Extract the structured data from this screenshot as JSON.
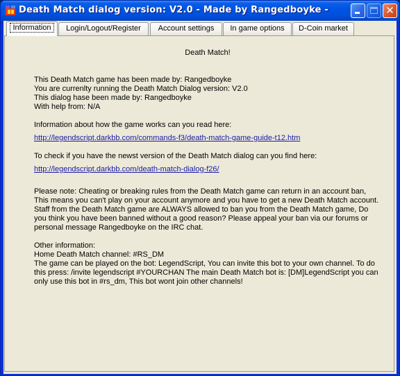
{
  "window": {
    "title": "Death Match dialog version: V2.0 - Made by Rangedboyke -",
    "app_icon": "app-icon",
    "controls": {
      "minimize": "minimize-icon",
      "maximize": "maximize-icon",
      "close": "close-icon",
      "close_glyph": "✕"
    }
  },
  "tabs": [
    {
      "label": "Information",
      "active": true
    },
    {
      "label": "Login/Logout/Register",
      "active": false
    },
    {
      "label": "Account settings",
      "active": false
    },
    {
      "label": "In game options",
      "active": false
    },
    {
      "label": "D-Coin market",
      "active": false
    }
  ],
  "info": {
    "heading": "Death Match!",
    "credits": [
      "This Death Match game has been made by: Rangedboyke",
      "You are currenlty running the Death Match Dialog version: V2.0",
      "This dialog hase been made by: Rangedboyke",
      "With help from: N/A"
    ],
    "guide_text": "Information about how the game works can you read here:",
    "guide_link": "http://legendscript.darkbb.com/commands-f3/death-match-game-guide-t12.htm",
    "version_text": "To check if you have the newst version of the Death Match dialog can you find here:",
    "version_link": "http://legendscript.darkbb.com/death-match-dialog-f26/",
    "note": "Please note: Cheating or breaking rules from the Death Match game can return in an account ban, This means you can't play on your account anymore and you have to get a new Death Match account. Staff from the Death Match game are ALWAYS allowed to ban you from the Death Match game, Do you think you have been banned without a good reason? Please appeal your ban via our forums or personal message Rangedboyke on the IRC chat.",
    "other_heading": "Other information:",
    "home_channel": "Home Death Match channel: #RS_DM",
    "bot_info": "The game can be played on the bot: LegendScript, You can invite this bot to your own channel. To do this press: /invite legendscript #YOURCHAN The main Death Match bot is: [DM]LegendScript you can only use this bot in #rs_dm, This bot wont join other channels!"
  }
}
